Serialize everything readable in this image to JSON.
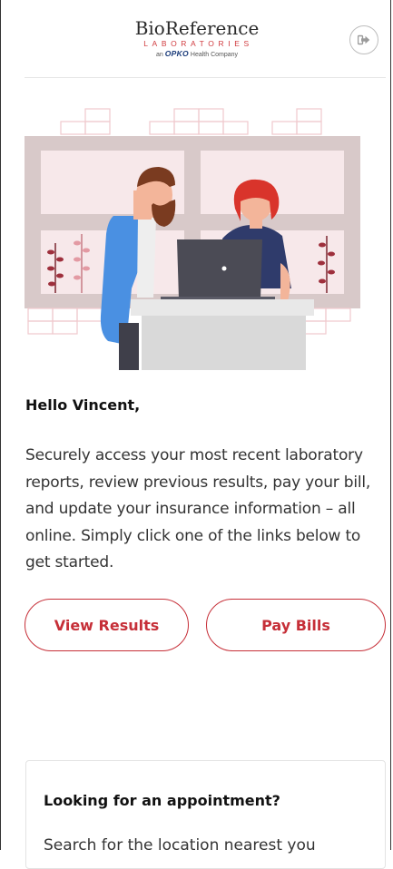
{
  "header": {
    "logo": {
      "brand": "BioReference",
      "sub": "LABORATORIES",
      "parent_prefix": "an",
      "parent_brand": "OPKO",
      "parent_suffix": "Health Company"
    },
    "logout_icon": "sign-out-icon"
  },
  "hero": {
    "illustration": "people-at-laptop-illustration"
  },
  "greeting": "Hello Vincent,",
  "intro": "Securely access your most recent laboratory reports, review previous results, pay your bill, and update your insurance information – all online. Simply click one of the links below to get started.",
  "actions": {
    "view_results": "View Results",
    "pay_bills": "Pay Bills"
  },
  "appointment": {
    "title": "Looking for an appointment?",
    "text": "Search for the location nearest you"
  },
  "colors": {
    "accent": "#c62f38",
    "wall": "#d8c9c9",
    "window": "#f7e8ea",
    "shirt_blue": "#4a90e2",
    "hair_red": "#d9342b",
    "laptop": "#4b4b55"
  }
}
